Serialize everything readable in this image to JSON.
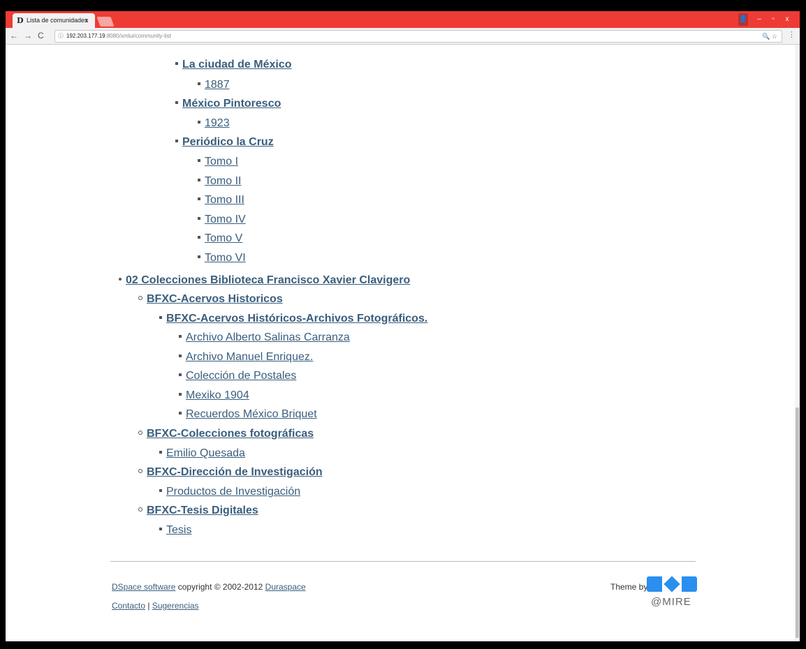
{
  "browser": {
    "tab_title": "Lista de comunidades",
    "tab_close": "x",
    "url_host": "192.203.177.19",
    "url_path": ":8080/xmlui/community-list",
    "win_min": "–",
    "win_restore": "▫",
    "win_close": "x"
  },
  "tree": {
    "partial_top": "La ciudad de México",
    "c1_sub": "1887",
    "c2": "México Pintoresco",
    "c2_sub": "1923",
    "c3": "Periódico la Cruz",
    "c3_items": [
      "Tomo I",
      "Tomo II",
      "Tomo III",
      "Tomo IV",
      "Tomo V",
      "Tomo VI"
    ],
    "root2": "02 Colecciones Biblioteca Francisco Xavier Clavigero",
    "s1": "BFXC-Acervos Historicos",
    "s1_sub": "BFXC-Acervos Históricos-Archivos Fotográficos.",
    "s1_items": [
      "Archivo Alberto Salinas Carranza",
      "Archivo Manuel Enriquez.",
      "Colección de Postales",
      "Mexiko 1904",
      "Recuerdos México Briquet"
    ],
    "s2": "BFXC-Colecciones fotográficas",
    "s2_sub": "Emilio Quesada",
    "s3": "BFXC-Dirección de Investigación",
    "s3_sub": "Productos de Investigación",
    "s4": "BFXC-Tesis Digitales",
    "s4_sub": "Tesis"
  },
  "footer": {
    "dspace": "DSpace software",
    "copyright": " copyright © 2002-2012 ",
    "duraspace": "Duraspace",
    "contacto": "Contacto",
    "sep": " | ",
    "sugerencias": "Sugerencias",
    "theme_by": "Theme by",
    "logo_text": "@MIRE"
  }
}
